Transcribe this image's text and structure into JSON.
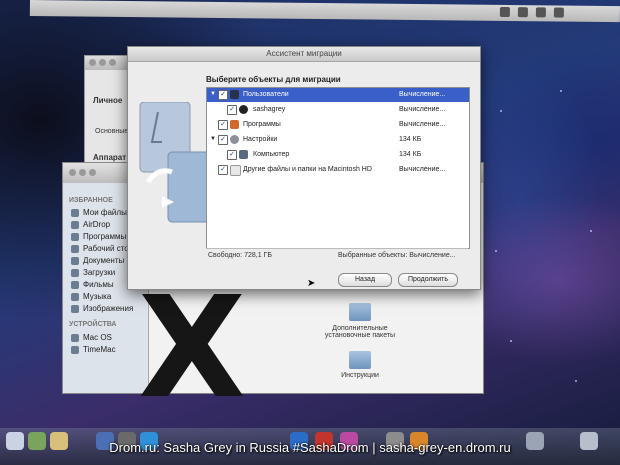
{
  "menubar": {
    "clock": "—"
  },
  "back_window": {
    "label": "Личное",
    "sublabel": "Основные",
    "label2": "Аппарат"
  },
  "finder_sidebar": {
    "favorites_header": "ИЗБРАННОЕ",
    "favorites": [
      "Мои файлы",
      "AirDrop",
      "Программы",
      "Рабочий стол",
      "Документы",
      "Загрузки",
      "Фильмы",
      "Музыка",
      "Изображения"
    ],
    "devices_header": "УСТРОЙСТВА",
    "devices": [
      "Mac OS",
      "TimeMac"
    ]
  },
  "finder_pane": {
    "folder1_label": "Дополнительные установочные пакеты",
    "folder2_label": "Инструкции"
  },
  "dialog": {
    "title": "Ассистент миграции",
    "heading": "Выберите объекты для миграции",
    "rows": [
      {
        "name": "Пользователи",
        "size": "Вычисление...",
        "selected": true
      },
      {
        "name": "sashagrey",
        "size": "Вычисление..."
      },
      {
        "name": "Программы",
        "size": "Вычисление..."
      },
      {
        "name": "Настройки",
        "size": "134 КБ"
      },
      {
        "name": "Компьютер",
        "size": "134 КБ"
      },
      {
        "name": "Другие файлы и папки на Macintosh HD",
        "size": "Вычисление..."
      }
    ],
    "free_space": "Свободно: 728,1 ГБ",
    "selected_objects": "Выбранные объекты: Вычисление...",
    "back_button": "Назад",
    "continue_button": "Продолжить"
  },
  "watermark": "Drom.ru: Sasha Grey in Russia #SashaDrom | sasha-grey-en.drom.ru",
  "colors": {
    "selection": "#3a5fc8",
    "dialog_bg": "#ececec"
  }
}
